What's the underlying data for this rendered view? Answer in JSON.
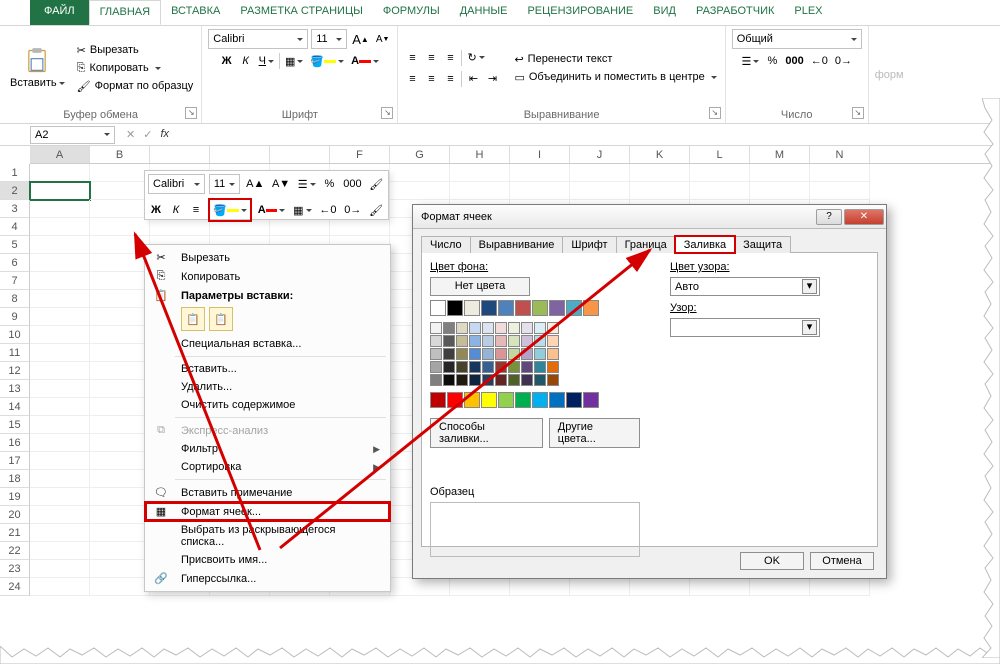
{
  "tabs": {
    "file": "ФАЙЛ",
    "home": "ГЛАВНАЯ",
    "insert": "ВСТАВКА",
    "layout": "РАЗМЕТКА СТРАНИЦЫ",
    "formulas": "ФОРМУЛЫ",
    "data": "ДАННЫЕ",
    "review": "РЕЦЕНЗИРОВАНИЕ",
    "view": "ВИД",
    "dev": "РАЗРАБОТЧИК",
    "plex": "PLEX"
  },
  "ribbon": {
    "clipboard": {
      "title": "Буфер обмена",
      "paste": "Вставить",
      "cut": "Вырезать",
      "copy": "Копировать",
      "painter": "Формат по образцу"
    },
    "font": {
      "title": "Шрифт",
      "name": "Calibri",
      "size": "11",
      "bold": "Ж",
      "italic": "К",
      "underline": "Ч"
    },
    "align": {
      "title": "Выравнивание",
      "wrap": "Перенести текст",
      "merge": "Объединить и поместить в центре"
    },
    "number": {
      "title": "Число",
      "format": "Общий"
    },
    "overflow": "форм"
  },
  "namebox": "A2",
  "columns": [
    "A",
    "B",
    "",
    "",
    "",
    "F",
    "G",
    "H",
    "I",
    "J",
    "K",
    "L",
    "M",
    "N"
  ],
  "rows": [
    "1",
    "2",
    "3",
    "4",
    "5",
    "6",
    "7",
    "8",
    "9",
    "10",
    "11",
    "12",
    "13",
    "14",
    "15",
    "16",
    "17",
    "18",
    "19",
    "20",
    "21",
    "22",
    "23",
    "24"
  ],
  "mini": {
    "font": "Calibri",
    "size": "11",
    "bold": "Ж",
    "italic": "К"
  },
  "ctx": {
    "cut": "Вырезать",
    "copy": "Копировать",
    "paste_hdr": "Параметры вставки:",
    "paste_special": "Специальная вставка...",
    "insert": "Вставить...",
    "delete": "Удалить...",
    "clear": "Очистить содержимое",
    "quick": "Экспресс-анализ",
    "filter": "Фильтр",
    "sort": "Сортировка",
    "comment": "Вставить примечание",
    "format": "Формат ячеек...",
    "dropdown": "Выбрать из раскрывающегося списка...",
    "name": "Присвоить имя...",
    "hyperlink": "Гиперссылка..."
  },
  "dlg": {
    "title": "Формат ячеек",
    "tabs": {
      "number": "Число",
      "align": "Выравнивание",
      "font": "Шрифт",
      "border": "Граница",
      "fill": "Заливка",
      "protect": "Защита"
    },
    "fill": {
      "bgcolor": "Цвет фона:",
      "nocolor": "Нет цвета",
      "patterncolor": "Цвет узора:",
      "auto": "Авто",
      "pattern": "Узор:",
      "methods": "Способы заливки...",
      "other": "Другие цвета...",
      "sample": "Образец"
    },
    "ok": "OK",
    "cancel": "Отмена"
  },
  "palette": {
    "basic": [
      "#ffffff",
      "#000000",
      "#eeece1",
      "#1f497d",
      "#4f81bd",
      "#c0504d",
      "#9bbb59",
      "#8064a2",
      "#4bacc6",
      "#f79646"
    ],
    "grid": [
      [
        "#f2f2f2",
        "#7f7f7f",
        "#ddd9c3",
        "#c6d9f0",
        "#dbe5f1",
        "#f2dcdb",
        "#ebf1dd",
        "#e5e0ec",
        "#dbeef3",
        "#fdeada"
      ],
      [
        "#d8d8d8",
        "#595959",
        "#c4bd97",
        "#8db3e2",
        "#b8cce4",
        "#e5b9b7",
        "#d7e3bc",
        "#ccc1d9",
        "#b7dde8",
        "#fbd5b5"
      ],
      [
        "#bfbfbf",
        "#3f3f3f",
        "#938953",
        "#548dd4",
        "#95b3d7",
        "#d99694",
        "#c3d69b",
        "#b2a2c7",
        "#92cddc",
        "#fac08f"
      ],
      [
        "#a5a5a5",
        "#262626",
        "#494429",
        "#17365d",
        "#366092",
        "#953734",
        "#76923c",
        "#5f497a",
        "#31859b",
        "#e36c09"
      ],
      [
        "#7f7f7f",
        "#0c0c0c",
        "#1d1b10",
        "#0f243e",
        "#244061",
        "#632423",
        "#4f6128",
        "#3f3151",
        "#205867",
        "#974806"
      ]
    ],
    "std": [
      "#c00000",
      "#ff0000",
      "#ffc000",
      "#ffff00",
      "#92d050",
      "#00b050",
      "#00b0f0",
      "#0070c0",
      "#002060",
      "#7030a0"
    ]
  }
}
